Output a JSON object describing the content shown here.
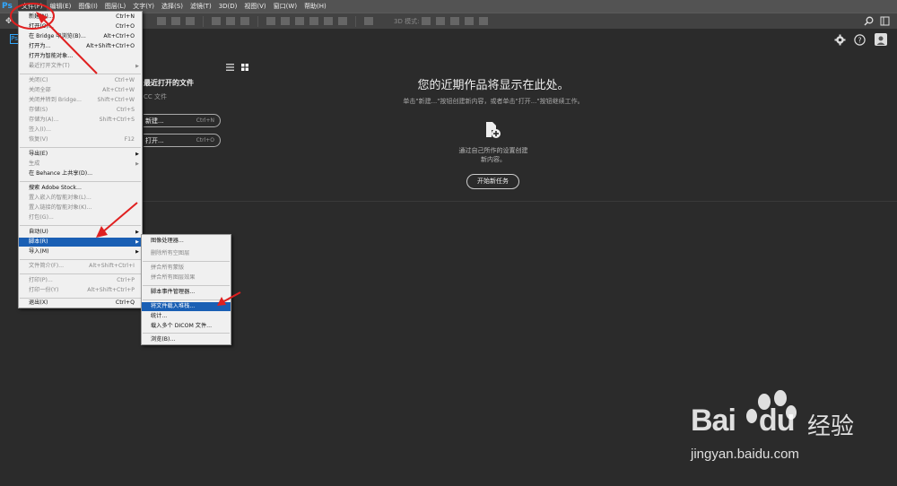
{
  "app": {
    "logo": "Ps",
    "tab_label": "Ps"
  },
  "menubar": {
    "items": [
      "文件(F)",
      "编辑(E)",
      "图像(I)",
      "图层(L)",
      "文字(Y)",
      "选择(S)",
      "滤镜(T)",
      "3D(D)",
      "视图(V)",
      "窗口(W)",
      "帮助(H)"
    ]
  },
  "options_bar": {
    "mode_label": "3D 模式:"
  },
  "home": {
    "recent_title": "最近打开的文件",
    "recent_sub": "CC 文件",
    "new_label": "新建...",
    "new_shortcut": "Ctrl+N",
    "open_label": "打开...",
    "open_shortcut": "Ctrl+O",
    "main_title": "您的近期作品将显示在此处。",
    "main_sub": "单击\"新建...\"按钮创建新内容，或者单击\"打开...\"按钮继续工作。",
    "desc_line1": "通过自己所作的设置创建",
    "desc_line2": "新内容。",
    "start_label": "开始新任务"
  },
  "file_menu": {
    "items": [
      {
        "label": "新建(N)...",
        "shortcut": "Ctrl+N"
      },
      {
        "label": "打开(O)...",
        "shortcut": "Ctrl+O"
      },
      {
        "label": "在 Bridge 中浏览(B)...",
        "shortcut": "Alt+Ctrl+O"
      },
      {
        "label": "打开为...",
        "shortcut": "Alt+Shift+Ctrl+O"
      },
      {
        "label": "打开为智能对象...",
        "shortcut": ""
      },
      {
        "label": "最近打开文件(T)",
        "shortcut": ""
      },
      {
        "label": "关闭(C)",
        "shortcut": "Ctrl+W"
      },
      {
        "label": "关闭全部",
        "shortcut": "Alt+Ctrl+W"
      },
      {
        "label": "关闭并转到 Bridge...",
        "shortcut": "Shift+Ctrl+W"
      },
      {
        "label": "存储(S)",
        "shortcut": "Ctrl+S"
      },
      {
        "label": "存储为(A)...",
        "shortcut": "Shift+Ctrl+S"
      },
      {
        "label": "签入(I)...",
        "shortcut": ""
      },
      {
        "label": "恢复(V)",
        "shortcut": "F12"
      },
      {
        "label": "导出(E)",
        "shortcut": ""
      },
      {
        "label": "生成",
        "shortcut": ""
      },
      {
        "label": "在 Behance 上共享(D)...",
        "shortcut": ""
      },
      {
        "label": "搜索 Adobe Stock...",
        "shortcut": ""
      },
      {
        "label": "置入嵌入的智能对象(L)...",
        "shortcut": ""
      },
      {
        "label": "置入链接的智能对象(K)...",
        "shortcut": ""
      },
      {
        "label": "打包(G)...",
        "shortcut": ""
      },
      {
        "label": "自动(U)",
        "shortcut": ""
      },
      {
        "label": "脚本(R)",
        "shortcut": ""
      },
      {
        "label": "导入(M)",
        "shortcut": ""
      },
      {
        "label": "文件简介(F)...",
        "shortcut": "Alt+Shift+Ctrl+I"
      },
      {
        "label": "打印(P)...",
        "shortcut": "Ctrl+P"
      },
      {
        "label": "打印一份(Y)",
        "shortcut": "Alt+Shift+Ctrl+P"
      },
      {
        "label": "退出(X)",
        "shortcut": "Ctrl+Q"
      }
    ]
  },
  "scripts_menu": {
    "items": [
      {
        "label": "图像处理器..."
      },
      {
        "label": "删除所有空图层"
      },
      {
        "label": "拼合所有蒙版"
      },
      {
        "label": "拼合所有图层效果"
      },
      {
        "label": "脚本事件管理器..."
      },
      {
        "label": "将文件载入堆栈..."
      },
      {
        "label": "统计..."
      },
      {
        "label": "载入多个 DICOM 文件..."
      },
      {
        "label": "浏览(B)..."
      }
    ]
  },
  "watermark": {
    "brand": "Bai",
    "brand_suffix": "du",
    "cn": "经验",
    "url": "jingyan.baidu.com"
  },
  "colors": {
    "highlight": "#1a5fb4",
    "annotation": "#e02020",
    "ps_blue": "#31a8ff"
  }
}
